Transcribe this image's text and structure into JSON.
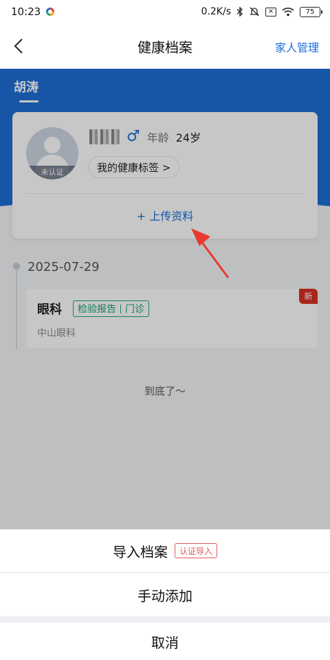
{
  "status_bar": {
    "time": "10:23",
    "network_speed": "0.2K/s",
    "battery": "75"
  },
  "nav": {
    "title": "健康档案",
    "right_action": "家人管理"
  },
  "owner": {
    "name": "胡涛"
  },
  "profile": {
    "avatar_badge": "未认证",
    "gender_symbol": "♂",
    "age_label": "年龄",
    "age_value": "24岁",
    "health_tag_button": "我的健康标签 >",
    "upload_button": "+ 上传资料"
  },
  "timeline": {
    "date": "2025-07-29",
    "record": {
      "department": "眼科",
      "tag_left": "检验报告",
      "tag_right": "门诊",
      "hospital": "中山眼科",
      "new_badge": "新"
    },
    "end_text": "到底了～"
  },
  "action_sheet": {
    "import_label": "导入档案",
    "import_tag": "认证导入",
    "manual_label": "手动添加",
    "cancel_label": "取消"
  },
  "colors": {
    "brand_blue": "#1e6fd6",
    "accent_green": "#18a37a",
    "badge_red": "#d93025",
    "arrow_red": "#e8392f"
  }
}
